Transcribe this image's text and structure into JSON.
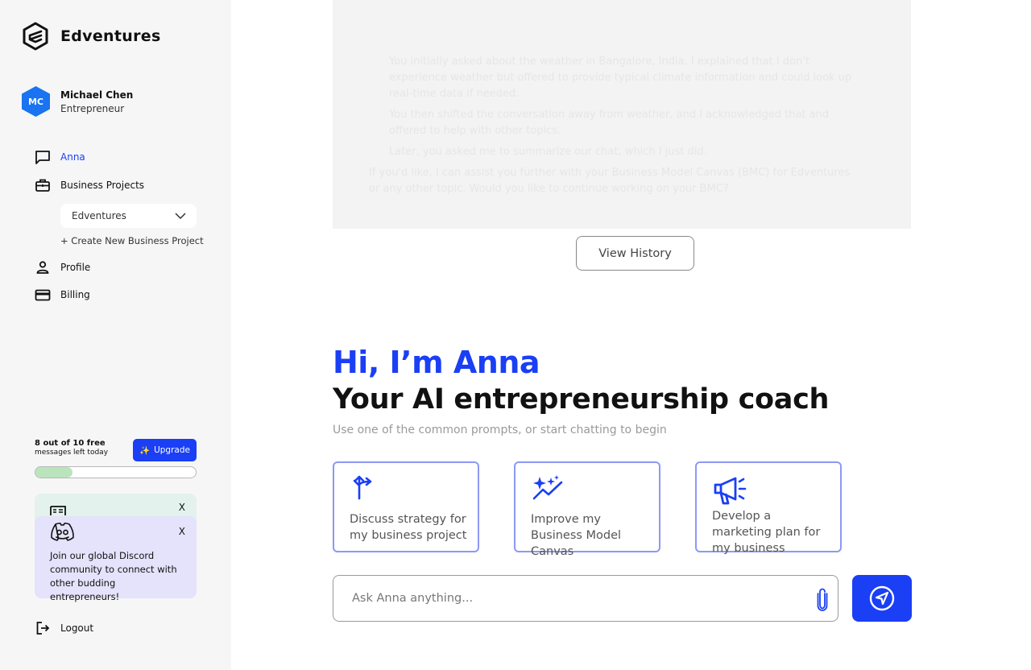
{
  "brand": {
    "name": "Edventures"
  },
  "user": {
    "initials": "MC",
    "name": "Michael Chen",
    "role": "Entrepreneur",
    "avatar_color": "#1a73f0"
  },
  "nav": {
    "anna": "Anna",
    "business_projects": "Business Projects",
    "project_selected": "Edventures",
    "create_project": "+ Create New Business Project",
    "profile": "Profile",
    "billing": "Billing",
    "logout": "Logout"
  },
  "usage": {
    "title": "8 out of 10 free",
    "subtitle": "messages left today",
    "upgrade_label": "Upgrade",
    "used_fraction": 0.23
  },
  "cards": {
    "close_label": "X",
    "discord_text": "Join our global Discord community to connect with other budding entrepreneurs!"
  },
  "history": {
    "bullets": [
      "You initially asked about the weather in Bangalore, India. I explained that I don't experience weather but offered to provide typical climate information and could look up real-time data if needed.",
      "You then shifted the conversation away from weather, and I acknowledged that and offered to help with other topics.",
      "Later, you asked me to summarize our chat, which I just did."
    ],
    "followup": "If you'd like, I can assist you further with your Business Model Canvas (BMC) for Edventures or any other topic. Would you like to continue working on your BMC?",
    "view_history_label": "View History"
  },
  "hero": {
    "greeting": "Hi, I’m Anna",
    "tagline": "Your AI entrepreneurship coach",
    "hint": "Use one of the common prompts, or start chatting to begin"
  },
  "prompts": [
    {
      "label": "Discuss strategy for my business project",
      "icon": "strategy-arrow-icon"
    },
    {
      "label": "Improve my Business Model Canvas",
      "icon": "sparkles-icon"
    },
    {
      "label": "Develop a marketing plan for my business",
      "icon": "megaphone-icon"
    }
  ],
  "chat": {
    "placeholder": "Ask Anna anything..."
  },
  "colors": {
    "accent": "#1a3ff5",
    "prompt_border": "#8d98f4",
    "progress": "#b9e4bc"
  }
}
